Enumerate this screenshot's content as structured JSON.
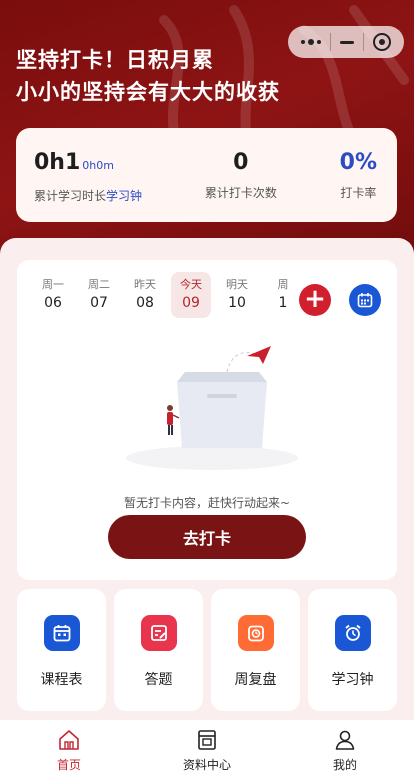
{
  "colors": {
    "brand_dark_red": "#7a1414",
    "accent_red": "#d21f2d",
    "accent_blue": "#1a57d4",
    "link_blue": "#2d4bc5",
    "tab_active": "#c22832"
  },
  "header": {
    "slogan_line1": "坚持打卡！日积月累",
    "slogan_line2": "小小的坚持会有大大的收获"
  },
  "stats": {
    "study_time_value": "0h1",
    "study_time_sub": "0h0m",
    "study_time_label": "累计学习时长",
    "study_time_link": "学习钟",
    "checkin_count_value": "0",
    "checkin_count_label": "累计打卡次数",
    "checkin_rate_value": "0%",
    "checkin_rate_label": "打卡率"
  },
  "dates": [
    {
      "weekday": "周一",
      "day": "06"
    },
    {
      "weekday": "周二",
      "day": "07"
    },
    {
      "weekday": "昨天",
      "day": "08"
    },
    {
      "weekday": "今天",
      "day": "09",
      "active": true
    },
    {
      "weekday": "明天",
      "day": "10"
    },
    {
      "weekday": "周",
      "day": "1"
    }
  ],
  "checkin": {
    "add_button_icon": "plus-icon",
    "calendar_button_icon": "calendar-icon",
    "empty_text": "暂无打卡内容，赶快行动起来~",
    "go_button": "去打卡"
  },
  "tools": [
    {
      "label": "课程表",
      "icon": "schedule-icon",
      "color": "#1a57d4"
    },
    {
      "label": "答题",
      "icon": "quiz-icon",
      "color": "#e8344c"
    },
    {
      "label": "周复盘",
      "icon": "weekly-review-icon",
      "color": "#ff6b35"
    },
    {
      "label": "学习钟",
      "icon": "alarm-clock-icon",
      "color": "#1a57d4"
    }
  ],
  "tabbar": [
    {
      "label": "首页",
      "icon": "home-icon",
      "active": true
    },
    {
      "label": "资料中心",
      "icon": "document-icon"
    },
    {
      "label": "我的",
      "icon": "user-icon"
    }
  ]
}
